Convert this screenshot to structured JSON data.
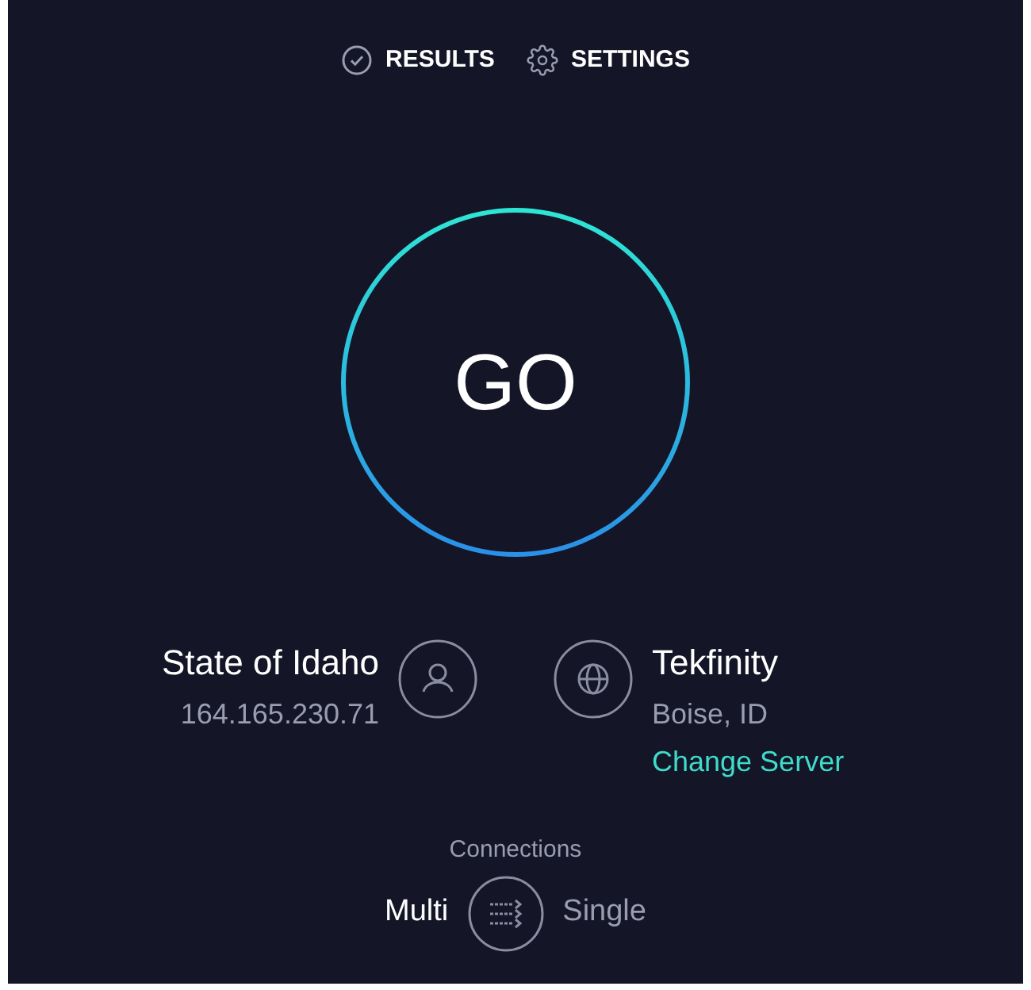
{
  "nav": [
    {
      "label": "RESULTS",
      "kind": "results"
    },
    {
      "label": "SETTINGS",
      "kind": "settings"
    }
  ],
  "go_button": {
    "label": "GO"
  },
  "isp": {
    "name": "State of Idaho",
    "ip": "164.165.230.71"
  },
  "server": {
    "name": "Tekfinity",
    "location": "Boise, ID",
    "link": "Change Server"
  },
  "connections": {
    "label": "Connections",
    "options": [
      {
        "label": "Multi",
        "selected": true
      },
      {
        "label": "Single",
        "selected": false
      }
    ]
  }
}
